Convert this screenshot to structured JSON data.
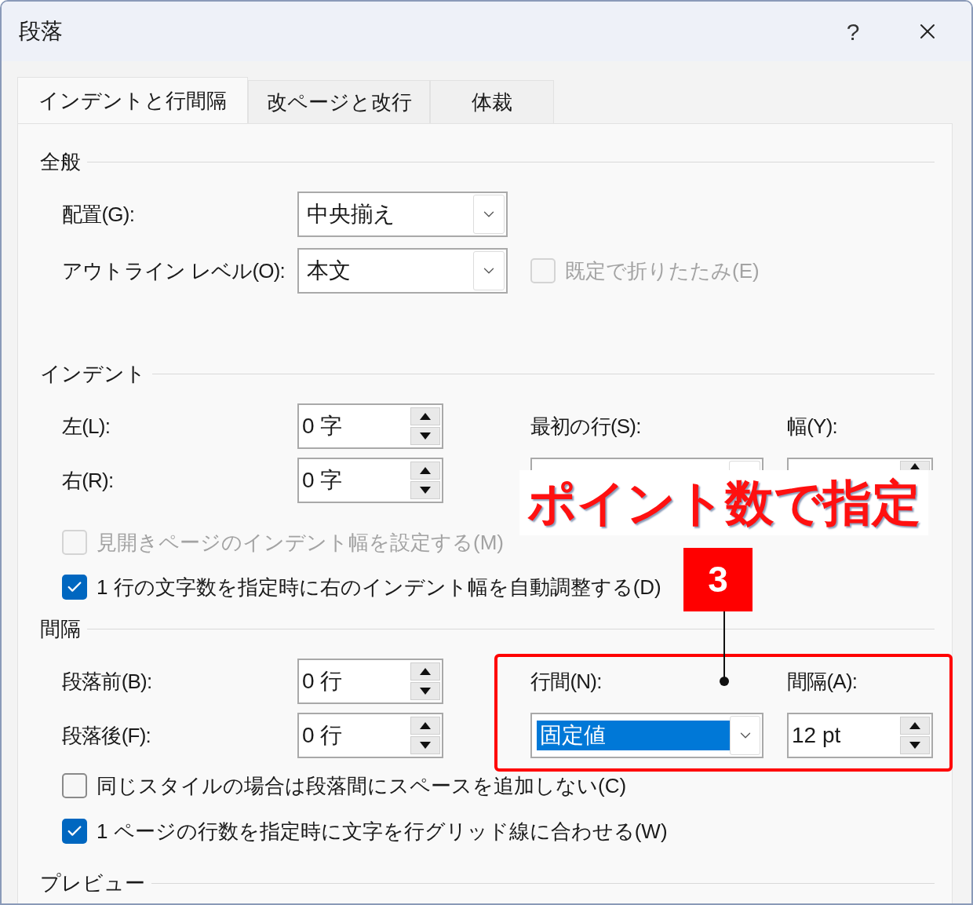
{
  "window": {
    "title": "段落",
    "help": "?"
  },
  "tabs": [
    {
      "label": "インデントと行間隔",
      "selected": true
    },
    {
      "label": "改ページと改行",
      "selected": false
    },
    {
      "label": "体裁",
      "selected": false
    }
  ],
  "general": {
    "heading": "全般",
    "alignment": {
      "label": "配置(G):",
      "value": "中央揃え"
    },
    "outline_level": {
      "label": "アウトライン レベル(O):",
      "value": "本文"
    },
    "collapse": {
      "label": "既定で折りたたみ(E)",
      "checked": false,
      "disabled": true
    }
  },
  "indent": {
    "heading": "インデント",
    "left": {
      "label": "左(L):",
      "value": "0 字"
    },
    "right": {
      "label": "右(R):",
      "value": "0 字"
    },
    "first_line": {
      "label": "最初の行(S):"
    },
    "by": {
      "label": "幅(Y):"
    },
    "options": [
      {
        "label": "見開きページのインデント幅を設定する(M)",
        "checked": false,
        "disabled": true
      },
      {
        "label": "1 行の文字数を指定時に右のインデント幅を自動調整する(D)",
        "checked": true,
        "disabled": false
      }
    ]
  },
  "spacing": {
    "heading": "間隔",
    "before": {
      "label": "段落前(B):",
      "value": "0 行"
    },
    "after": {
      "label": "段落後(F):",
      "value": "0 行"
    },
    "line_spacing": {
      "label": "行間(N):",
      "value": "固定値"
    },
    "at": {
      "label": "間隔(A):",
      "value": "12 pt"
    },
    "options": [
      {
        "label": "同じスタイルの場合は段落間にスペースを追加しない(C)",
        "checked": false,
        "disabled": false
      },
      {
        "label": "1 ページの行数を指定時に文字を行グリッド線に合わせる(W)",
        "checked": true,
        "disabled": false
      }
    ]
  },
  "preview": {
    "heading": "プレビュー"
  },
  "annotation": {
    "callout": "ポイント数で指定",
    "step": "3"
  }
}
